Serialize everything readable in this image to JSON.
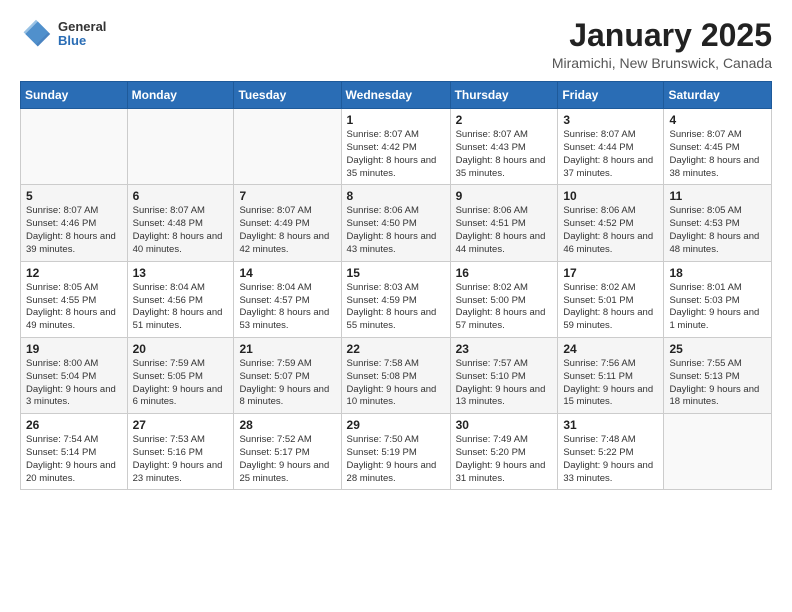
{
  "header": {
    "logo_general": "General",
    "logo_blue": "Blue",
    "title": "January 2025",
    "location": "Miramichi, New Brunswick, Canada"
  },
  "days_of_week": [
    "Sunday",
    "Monday",
    "Tuesday",
    "Wednesday",
    "Thursday",
    "Friday",
    "Saturday"
  ],
  "weeks": [
    [
      {
        "num": "",
        "info": ""
      },
      {
        "num": "",
        "info": ""
      },
      {
        "num": "",
        "info": ""
      },
      {
        "num": "1",
        "info": "Sunrise: 8:07 AM\nSunset: 4:42 PM\nDaylight: 8 hours and 35 minutes."
      },
      {
        "num": "2",
        "info": "Sunrise: 8:07 AM\nSunset: 4:43 PM\nDaylight: 8 hours and 35 minutes."
      },
      {
        "num": "3",
        "info": "Sunrise: 8:07 AM\nSunset: 4:44 PM\nDaylight: 8 hours and 37 minutes."
      },
      {
        "num": "4",
        "info": "Sunrise: 8:07 AM\nSunset: 4:45 PM\nDaylight: 8 hours and 38 minutes."
      }
    ],
    [
      {
        "num": "5",
        "info": "Sunrise: 8:07 AM\nSunset: 4:46 PM\nDaylight: 8 hours and 39 minutes."
      },
      {
        "num": "6",
        "info": "Sunrise: 8:07 AM\nSunset: 4:48 PM\nDaylight: 8 hours and 40 minutes."
      },
      {
        "num": "7",
        "info": "Sunrise: 8:07 AM\nSunset: 4:49 PM\nDaylight: 8 hours and 42 minutes."
      },
      {
        "num": "8",
        "info": "Sunrise: 8:06 AM\nSunset: 4:50 PM\nDaylight: 8 hours and 43 minutes."
      },
      {
        "num": "9",
        "info": "Sunrise: 8:06 AM\nSunset: 4:51 PM\nDaylight: 8 hours and 44 minutes."
      },
      {
        "num": "10",
        "info": "Sunrise: 8:06 AM\nSunset: 4:52 PM\nDaylight: 8 hours and 46 minutes."
      },
      {
        "num": "11",
        "info": "Sunrise: 8:05 AM\nSunset: 4:53 PM\nDaylight: 8 hours and 48 minutes."
      }
    ],
    [
      {
        "num": "12",
        "info": "Sunrise: 8:05 AM\nSunset: 4:55 PM\nDaylight: 8 hours and 49 minutes."
      },
      {
        "num": "13",
        "info": "Sunrise: 8:04 AM\nSunset: 4:56 PM\nDaylight: 8 hours and 51 minutes."
      },
      {
        "num": "14",
        "info": "Sunrise: 8:04 AM\nSunset: 4:57 PM\nDaylight: 8 hours and 53 minutes."
      },
      {
        "num": "15",
        "info": "Sunrise: 8:03 AM\nSunset: 4:59 PM\nDaylight: 8 hours and 55 minutes."
      },
      {
        "num": "16",
        "info": "Sunrise: 8:02 AM\nSunset: 5:00 PM\nDaylight: 8 hours and 57 minutes."
      },
      {
        "num": "17",
        "info": "Sunrise: 8:02 AM\nSunset: 5:01 PM\nDaylight: 8 hours and 59 minutes."
      },
      {
        "num": "18",
        "info": "Sunrise: 8:01 AM\nSunset: 5:03 PM\nDaylight: 9 hours and 1 minute."
      }
    ],
    [
      {
        "num": "19",
        "info": "Sunrise: 8:00 AM\nSunset: 5:04 PM\nDaylight: 9 hours and 3 minutes."
      },
      {
        "num": "20",
        "info": "Sunrise: 7:59 AM\nSunset: 5:05 PM\nDaylight: 9 hours and 6 minutes."
      },
      {
        "num": "21",
        "info": "Sunrise: 7:59 AM\nSunset: 5:07 PM\nDaylight: 9 hours and 8 minutes."
      },
      {
        "num": "22",
        "info": "Sunrise: 7:58 AM\nSunset: 5:08 PM\nDaylight: 9 hours and 10 minutes."
      },
      {
        "num": "23",
        "info": "Sunrise: 7:57 AM\nSunset: 5:10 PM\nDaylight: 9 hours and 13 minutes."
      },
      {
        "num": "24",
        "info": "Sunrise: 7:56 AM\nSunset: 5:11 PM\nDaylight: 9 hours and 15 minutes."
      },
      {
        "num": "25",
        "info": "Sunrise: 7:55 AM\nSunset: 5:13 PM\nDaylight: 9 hours and 18 minutes."
      }
    ],
    [
      {
        "num": "26",
        "info": "Sunrise: 7:54 AM\nSunset: 5:14 PM\nDaylight: 9 hours and 20 minutes."
      },
      {
        "num": "27",
        "info": "Sunrise: 7:53 AM\nSunset: 5:16 PM\nDaylight: 9 hours and 23 minutes."
      },
      {
        "num": "28",
        "info": "Sunrise: 7:52 AM\nSunset: 5:17 PM\nDaylight: 9 hours and 25 minutes."
      },
      {
        "num": "29",
        "info": "Sunrise: 7:50 AM\nSunset: 5:19 PM\nDaylight: 9 hours and 28 minutes."
      },
      {
        "num": "30",
        "info": "Sunrise: 7:49 AM\nSunset: 5:20 PM\nDaylight: 9 hours and 31 minutes."
      },
      {
        "num": "31",
        "info": "Sunrise: 7:48 AM\nSunset: 5:22 PM\nDaylight: 9 hours and 33 minutes."
      },
      {
        "num": "",
        "info": ""
      }
    ]
  ]
}
